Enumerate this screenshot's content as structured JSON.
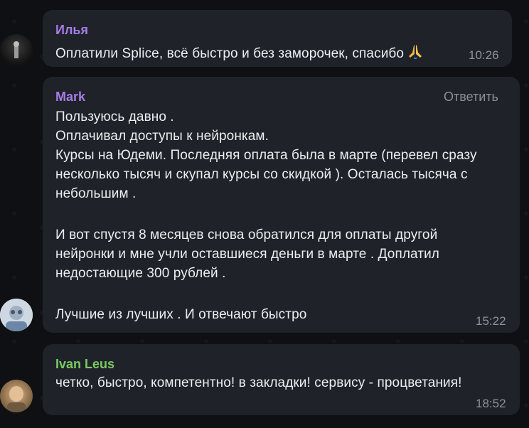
{
  "messages": [
    {
      "author": "Илья",
      "author_color": "#a77ce8",
      "lines": [
        "Оплатили Splice, всё быстро и без заморочек, спасибо"
      ],
      "emoji_icon": "folded-hands-icon",
      "time": "10:26"
    },
    {
      "author": "Mark",
      "author_color": "#a77ce8",
      "reply_label": "Ответить",
      "lines": [
        "Пользуюсь давно .",
        "Оплачивал доступы к нейронкам.",
        "Курсы на Юдеми. Последняя оплата была в марте (перевел сразу",
        "несколько тысяч и скупал курсы со скидкой ). Осталась тысяча с",
        "небольшим .",
        "",
        "И вот спустя 8 месяцев снова обратился для оплаты другой",
        "нейронки и мне учли оставшиеся деньги в марте . Доплатил",
        "недостающие 300 рублей .",
        "",
        "Лучшие из лучших . И отвечают быстро"
      ],
      "time": "15:22"
    },
    {
      "author": "Ivan Leus",
      "author_color": "#7bc862",
      "lines": [
        "четко, быстро, компетентно! в закладки! сервису - процветания!"
      ],
      "time": "18:52"
    }
  ],
  "colors": {
    "background": "#0e1013",
    "bubble": "#1f2329",
    "text": "#eceef0",
    "time": "#8d939a"
  }
}
